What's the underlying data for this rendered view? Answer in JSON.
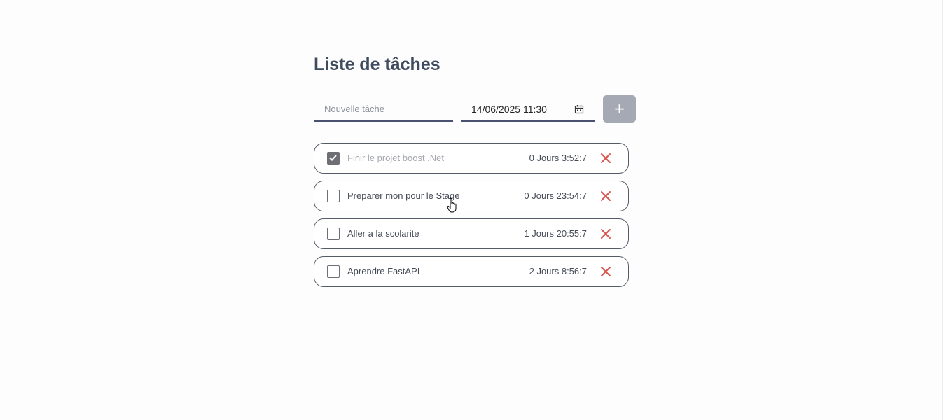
{
  "page": {
    "title": "Liste de tâches"
  },
  "form": {
    "task_placeholder": "Nouvelle tâche",
    "task_value": "",
    "date_value": "14/06/2025 11:30",
    "add_label": "+",
    "calendar_icon": "calendar-icon"
  },
  "tasks": [
    {
      "label": "Finir le projet boost .Net",
      "remaining": "0 Jours 3:52:7",
      "done": true
    },
    {
      "label": "Preparer mon pour le Stage",
      "remaining": "0 Jours 23:54:7",
      "done": false
    },
    {
      "label": "Aller a la scolarite",
      "remaining": "1 Jours 20:55:7",
      "done": false
    },
    {
      "label": "Aprendre FastAPI",
      "remaining": "2 Jours 8:56:7",
      "done": false
    }
  ],
  "colors": {
    "accent": "#4b5170",
    "delete": "#d9534f",
    "add_button": "#a5a9b4",
    "checked": "#6d6f74"
  }
}
